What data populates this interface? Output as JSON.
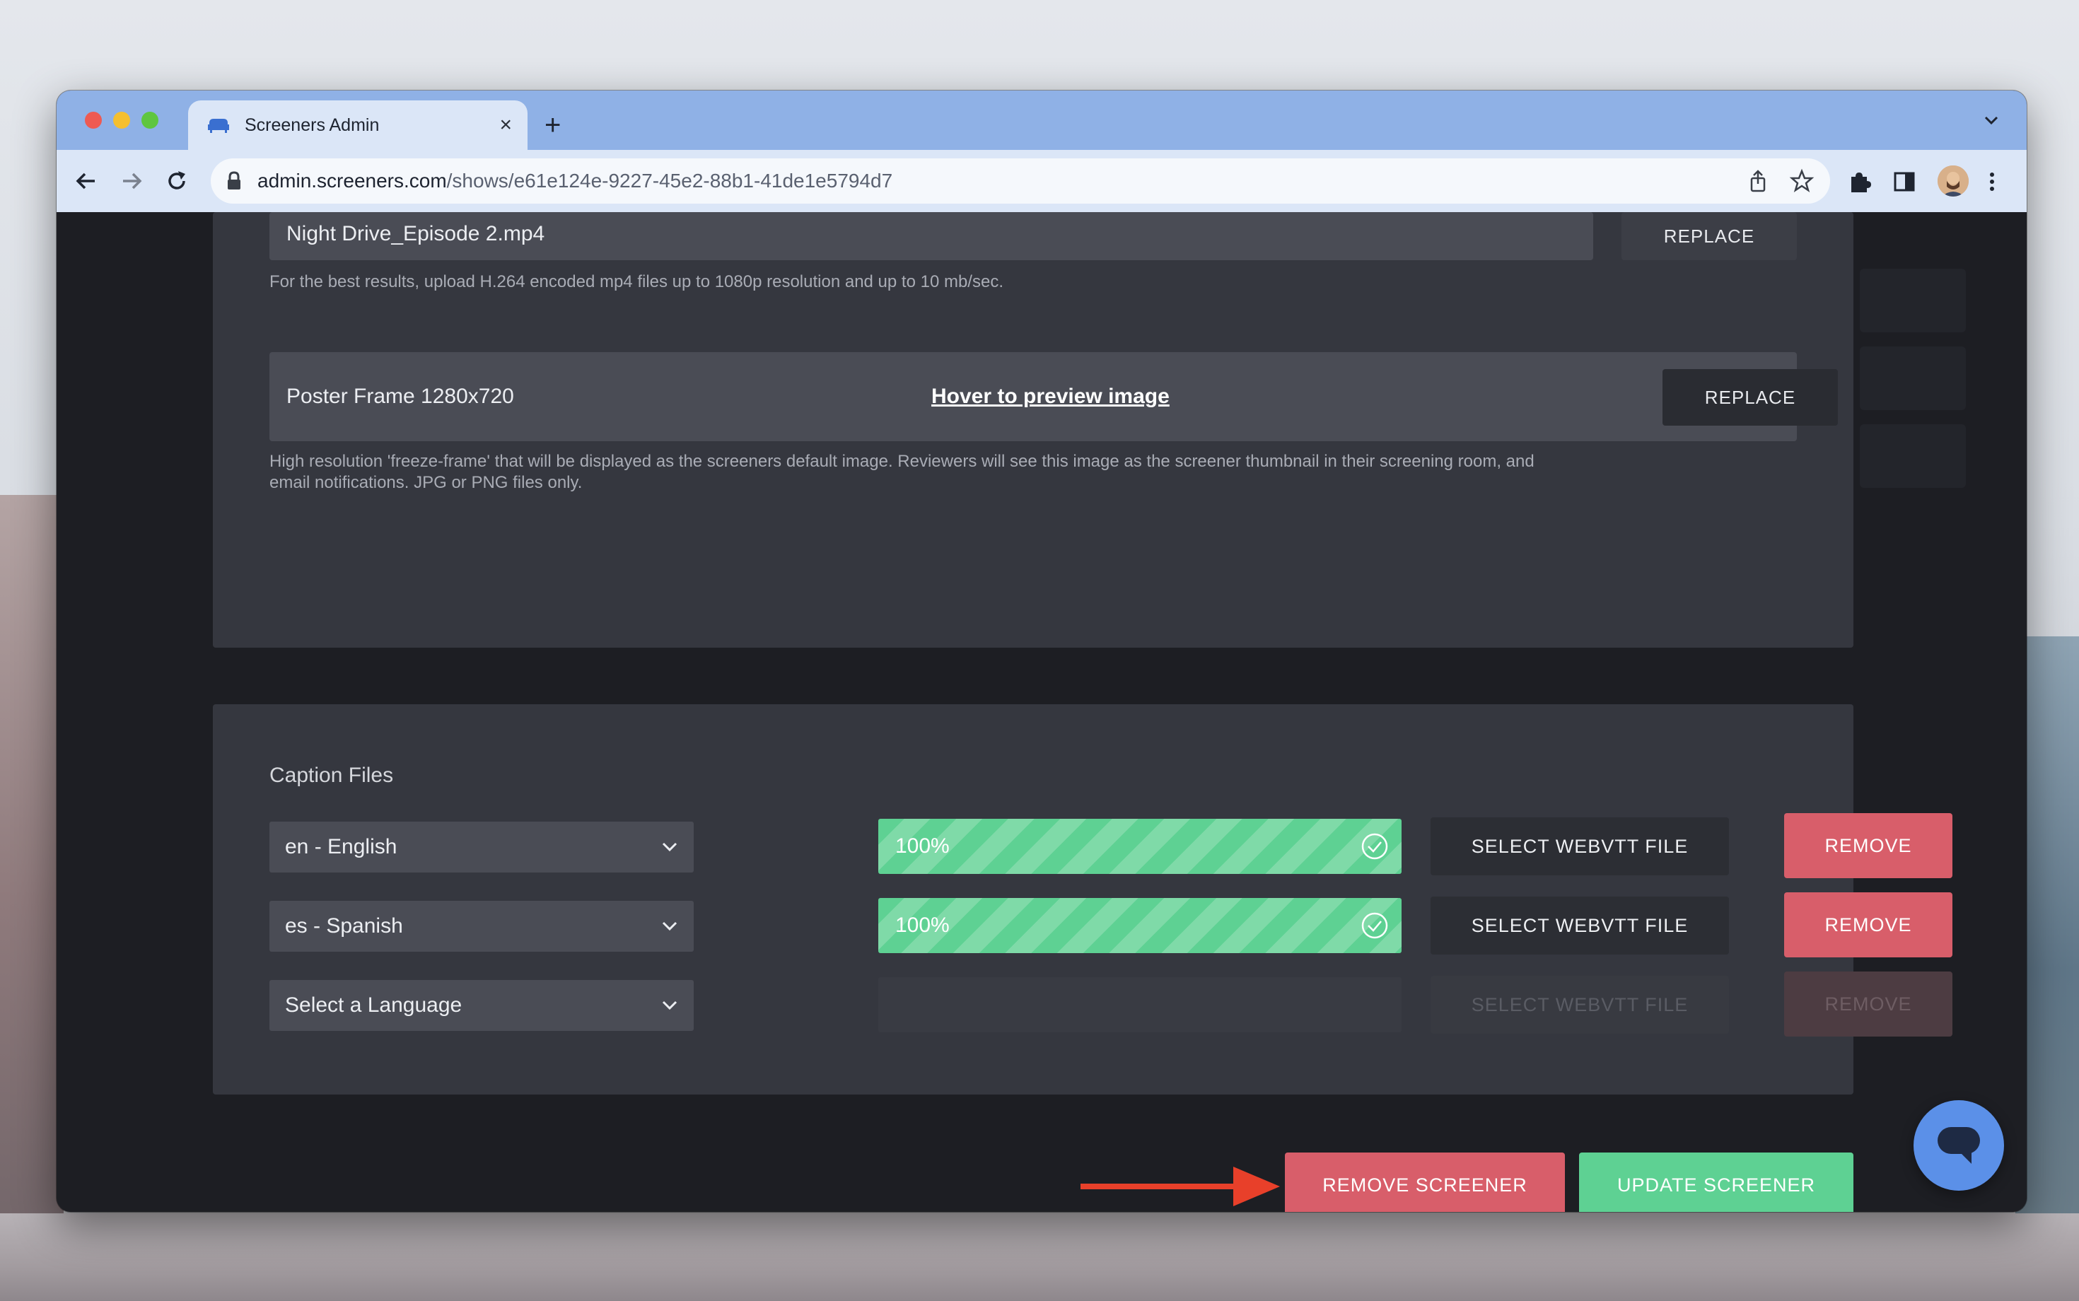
{
  "browser": {
    "tab_title": "Screeners Admin",
    "url_host": "admin.screeners.com",
    "url_path": "/shows/e61e124e-9227-45e2-88b1-41de1e5794d7",
    "new_tab_label": "+",
    "close_tab_label": "×"
  },
  "video_file": {
    "filename": "Night Drive_Episode 2.mp4",
    "replace_label": "REPLACE",
    "help": "For the best results, upload H.264 encoded mp4 files up to 1080p resolution and up to 10 mb/sec."
  },
  "poster_frame": {
    "label": "Poster Frame 1280x720",
    "preview_link": "Hover to preview image",
    "replace_label": "REPLACE",
    "help_line1": "High resolution 'freeze-frame' that will be displayed as the screeners default image. Reviewers will see this image as the screener thumbnail in their screening room, and",
    "help_line2": "email notifications. JPG or PNG files only."
  },
  "captions": {
    "title": "Caption Files",
    "rows": [
      {
        "language": "en - English",
        "progress_label": "100%",
        "progress": 1.0,
        "select_label": "SELECT WEBVTT FILE",
        "remove_label": "REMOVE"
      },
      {
        "language": "es - Spanish",
        "progress_label": "100%",
        "progress": 1.0,
        "select_label": "SELECT WEBVTT FILE",
        "remove_label": "REMOVE"
      },
      {
        "language": "Select a Language",
        "progress_label": "",
        "progress": 0,
        "select_label": "SELECT WEBVTT FILE",
        "remove_label": "REMOVE"
      }
    ]
  },
  "actions": {
    "remove_screener": "REMOVE SCREENER",
    "update_screener": "UPDATE SCREENER"
  },
  "colors": {
    "success": "#5ed193",
    "danger": "#d85e6a",
    "accent_arrow": "#e8402a",
    "chat": "#5b90e8"
  },
  "icons": [
    "back-arrow-icon",
    "forward-arrow-icon",
    "reload-icon",
    "lock-icon",
    "share-icon",
    "star-icon",
    "puzzle-icon",
    "sidebar-icon",
    "kebab-menu-icon",
    "chevron-down-icon",
    "check-circle-icon",
    "chat-icon"
  ]
}
